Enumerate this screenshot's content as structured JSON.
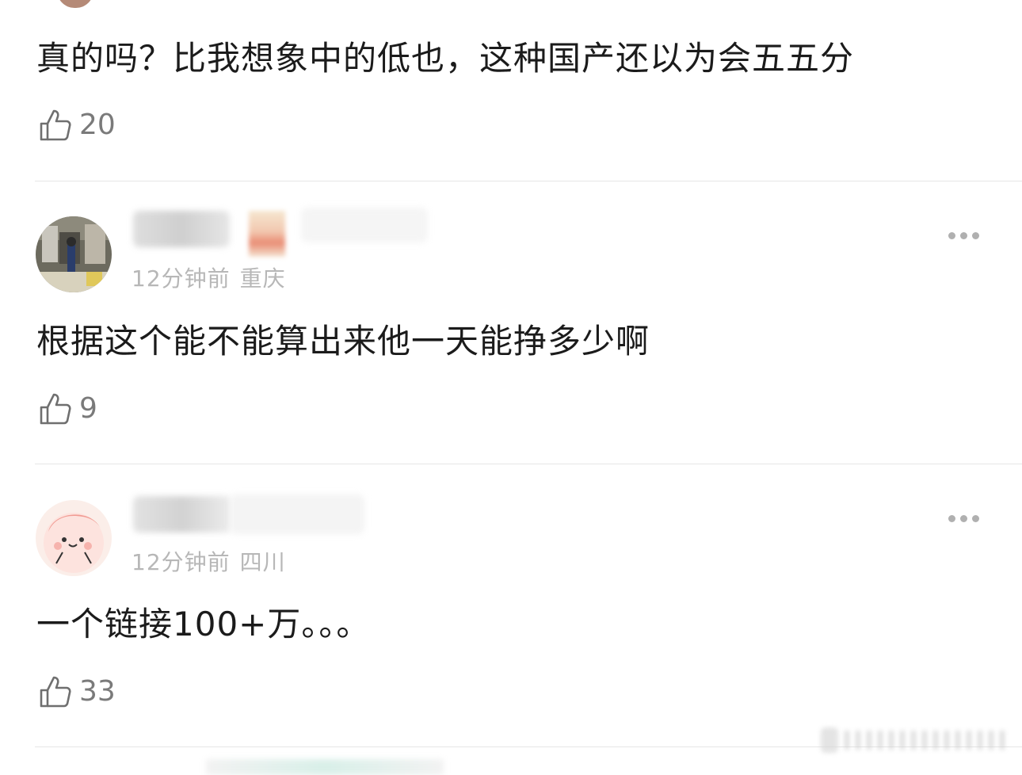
{
  "comments": [
    {
      "text": "真的吗？比我想象中的低也，这种国产还以为会五五分",
      "likes": "20"
    },
    {
      "time": "12分钟前",
      "location": "重庆",
      "text": "根据这个能不能算出来他一天能挣多少啊",
      "likes": "9"
    },
    {
      "time": "12分钟前",
      "location": "四川",
      "text": "一个链接100+万。。。",
      "likes": "33"
    }
  ],
  "icons": {
    "like": "thumbs-up-icon",
    "more": "more-dots-icon"
  }
}
